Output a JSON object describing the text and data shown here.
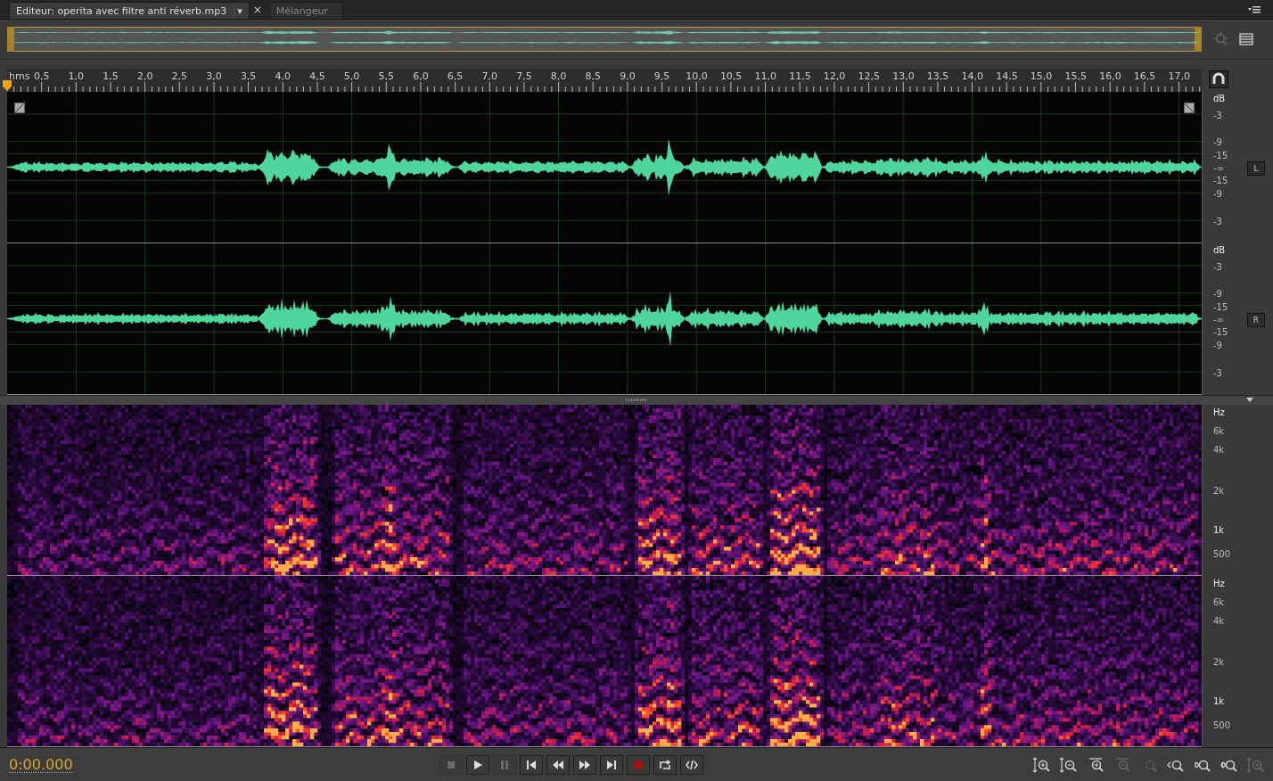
{
  "tabs": [
    {
      "label": "Editeur: operita avec filtre anti réverb.mp3",
      "selected": true,
      "dropdown": "▾",
      "close": "×"
    },
    {
      "label": "Mélangeur",
      "selected": false
    }
  ],
  "ruler": {
    "unit": "hms",
    "ticks": [
      "0,5",
      "1,0",
      "1,5",
      "2,0",
      "2,5",
      "3,0",
      "3,5",
      "4,0",
      "4,5",
      "5,0",
      "5,5",
      "6,0",
      "6,5",
      "7,0",
      "7,5",
      "8,0",
      "8,5",
      "9,0",
      "9,5",
      "10,0",
      "10,5",
      "11,0",
      "11,5",
      "12,0",
      "12,5",
      "13,0",
      "13,5",
      "14,0",
      "14,5",
      "15,0",
      "15,5",
      "16,0",
      "16,5",
      "17,0"
    ]
  },
  "channels": [
    {
      "label": "L",
      "db_scale": [
        "dB",
        "-3",
        "-9",
        "-15",
        "-∞",
        "-15",
        "-9",
        "-3"
      ]
    },
    {
      "label": "R",
      "db_scale": [
        "dB",
        "-3",
        "-9",
        "-15",
        "-∞",
        "-15",
        "-9",
        "-3"
      ]
    }
  ],
  "spectral": [
    {
      "hz_scale": [
        "Hz",
        "6k",
        "4k",
        "2k",
        "1k",
        "500"
      ]
    },
    {
      "hz_scale": [
        "Hz",
        "6k",
        "4k",
        "2k",
        "1k",
        "500"
      ]
    }
  ],
  "time": "0:00.000",
  "transport": [
    {
      "kind": "stop",
      "disabled": true
    },
    {
      "kind": "play",
      "disabled": false
    },
    {
      "kind": "pause",
      "disabled": true
    },
    {
      "kind": "start",
      "disabled": false
    },
    {
      "kind": "rewind",
      "disabled": false
    },
    {
      "kind": "forward",
      "disabled": false
    },
    {
      "kind": "end",
      "disabled": false
    },
    {
      "kind": "record",
      "disabled": false
    },
    {
      "kind": "loop",
      "disabled": false
    },
    {
      "kind": "skip",
      "disabled": false
    }
  ],
  "zoom": [
    {
      "kind": "in-v",
      "disabled": false
    },
    {
      "kind": "out-v",
      "disabled": false
    },
    {
      "kind": "in-h",
      "disabled": false
    },
    {
      "kind": "out-h",
      "disabled": true
    },
    {
      "kind": "sel",
      "disabled": true
    },
    {
      "kind": "left",
      "disabled": false
    },
    {
      "kind": "right",
      "disabled": false
    },
    {
      "kind": "both",
      "disabled": false
    },
    {
      "kind": "full",
      "disabled": true
    }
  ]
}
